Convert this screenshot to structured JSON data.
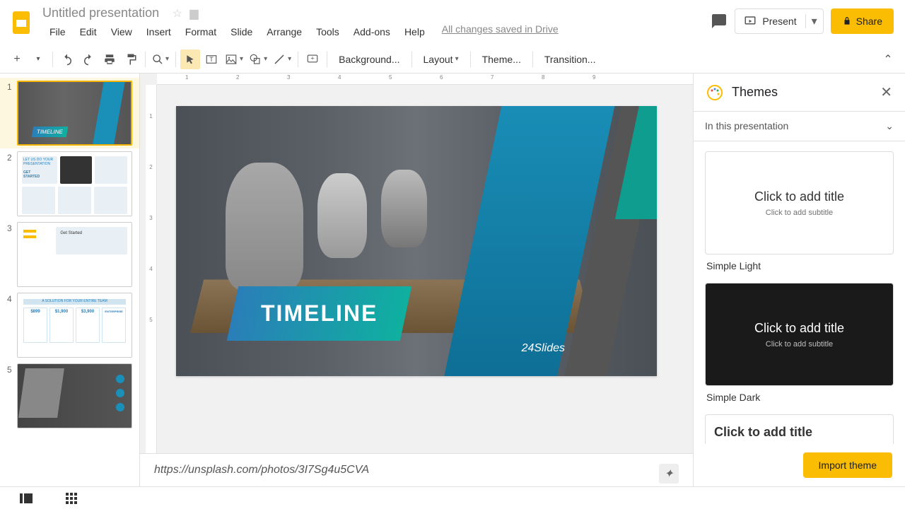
{
  "header": {
    "doc_title": "Untitled presentation",
    "menus": [
      "File",
      "Edit",
      "View",
      "Insert",
      "Format",
      "Slide",
      "Arrange",
      "Tools",
      "Add-ons",
      "Help"
    ],
    "saved": "All changes saved in Drive",
    "present": "Present",
    "share": "Share"
  },
  "toolbar": {
    "background": "Background...",
    "layout": "Layout",
    "theme": "Theme...",
    "transition": "Transition..."
  },
  "ruler_h": [
    "1",
    "2",
    "3",
    "4",
    "5",
    "6",
    "7",
    "8",
    "9"
  ],
  "ruler_v": [
    "1",
    "2",
    "3",
    "4",
    "5"
  ],
  "filmstrip": [
    {
      "n": "1",
      "type": "timeline",
      "label": "TIMELINE"
    },
    {
      "n": "2",
      "type": "content",
      "t1": "LET US DO YOUR",
      "t2": "PRESENTATION",
      "t3": "GET",
      "t4": "STARTED"
    },
    {
      "n": "3",
      "type": "content2",
      "txt": "Get Started"
    },
    {
      "n": "4",
      "type": "pricing",
      "p1": "$899",
      "p2": "$1,900",
      "p3": "$3,900",
      "p4": "ENTERPRISE",
      "hdr": "A SOLUTION FOR YOUR ENTIRE TEAM"
    },
    {
      "n": "5",
      "type": "timeline2"
    }
  ],
  "slide": {
    "title": "TIMELINE",
    "brand": "24Slides"
  },
  "notes": "https://unsplash.com/photos/3I7Sg4u5CVA",
  "themes": {
    "title": "Themes",
    "section": "In this presentation",
    "cards": [
      {
        "name": "Simple Light",
        "title": "Click to add title",
        "sub": "Click to add subtitle",
        "cls": "light"
      },
      {
        "name": "Simple Dark",
        "title": "Click to add title",
        "sub": "Click to add subtitle",
        "cls": "dark"
      },
      {
        "name": "",
        "title": "Click to add title",
        "sub": "",
        "cls": "light"
      }
    ],
    "import": "Import theme"
  }
}
